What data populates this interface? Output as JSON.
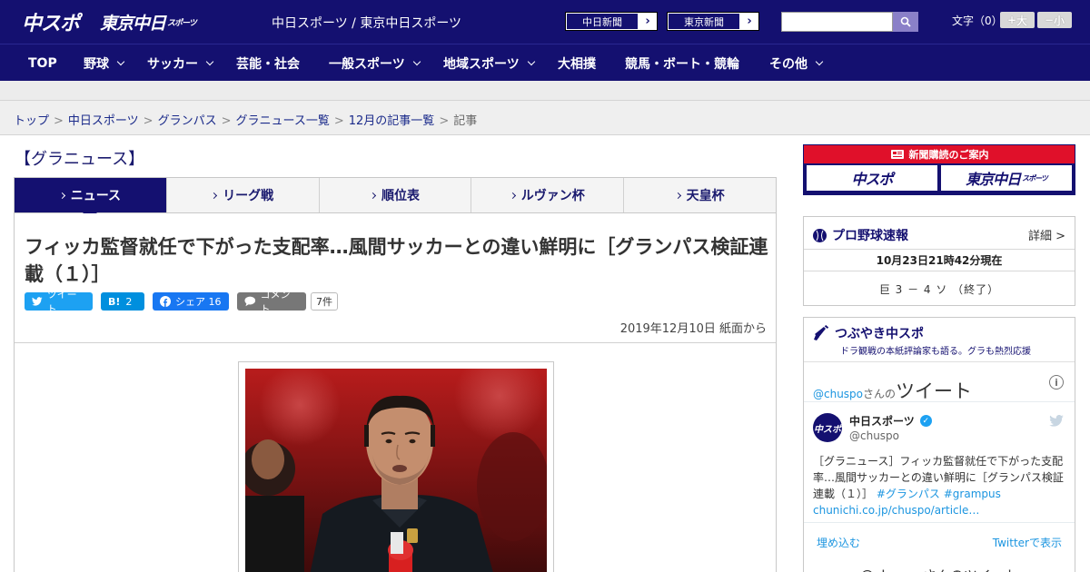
{
  "header": {
    "logo_chuspo": "中スポ",
    "logo_tokyo": "東京中日",
    "logo_tokyo_small": "スポーツ",
    "site_name": "中日スポーツ / 東京中日スポーツ",
    "links": [
      {
        "label": "中日新聞"
      },
      {
        "label": "東京新聞"
      }
    ],
    "search": {
      "value": "",
      "placeholder": ""
    },
    "font_size_label": "文字（0）",
    "font_bigger": "大",
    "font_smaller": "小"
  },
  "nav": {
    "items": [
      {
        "label": "TOP",
        "dropdown": false
      },
      {
        "label": "野球",
        "dropdown": true
      },
      {
        "label": "サッカー",
        "dropdown": true
      },
      {
        "label": "芸能・社会",
        "dropdown": false
      },
      {
        "label": "一般スポーツ",
        "dropdown": true
      },
      {
        "label": "地域スポーツ",
        "dropdown": true
      },
      {
        "label": "大相撲",
        "dropdown": false
      },
      {
        "label": "競馬・ボート・競輪",
        "dropdown": false
      },
      {
        "label": "その他",
        "dropdown": true
      }
    ]
  },
  "breadcrumb": {
    "items": [
      "トップ",
      "中日スポーツ",
      "グランパス",
      "グラニュース一覧",
      "12月の記事一覧"
    ],
    "current": "記事"
  },
  "category_title": "【グラニュース】",
  "tabs": [
    {
      "label": "ニュース",
      "active": true
    },
    {
      "label": "リーグ戦",
      "active": false
    },
    {
      "label": "順位表",
      "active": false
    },
    {
      "label": "ルヴァン杯",
      "active": false
    },
    {
      "label": "天皇杯",
      "active": false
    }
  ],
  "article": {
    "headline": "フィッカ監督就任で下がった支配率…風間サッカーとの違い鮮明に［グランパス検証連載（１）］",
    "share": {
      "tweet_label": "ツイート",
      "hatena_icon": "B!",
      "hatena_count": "2",
      "facebook_label": "シェア",
      "facebook_count": "16",
      "comment_label": "コメント",
      "comment_count": "7件"
    },
    "date": "2019年12月10日 紙面から"
  },
  "sidebar": {
    "ad": {
      "title": "新聞購読のご案内",
      "logo_left": "中スポ",
      "logo_right": "東京中日",
      "logo_right_small": "スポーツ"
    },
    "baseball": {
      "title": "プロ野球速報",
      "detail": "詳細 >",
      "time": "10月23日21時42分現在",
      "score": "巨 3 － 4 ソ （終了）"
    },
    "tweets": {
      "title": "つぶやき中スポ",
      "subtitle": "ドラ観戦の本紙評論家も語る。グラも熱烈応援",
      "handle": "@chuspo",
      "handle_suffix": "さんの",
      "handle_big": "ツイート",
      "tweet": {
        "avatar_text": "中スポ",
        "user": "中日スポーツ",
        "at": "@chuspo",
        "text": "［グラニュース］フィッカ監督就任で下がった支配率…風間サッカーとの違い鮮明に［グランパス検証連載（１）］",
        "tag1": "#グランパス",
        "tag2": "#grampus",
        "url": "chunichi.co.jp/chuspo/article…"
      },
      "embed": "埋め込む",
      "view_on_twitter": "Twitterで表示",
      "more": "@chuspoさんのツイート"
    }
  },
  "colors": {
    "navy": "#141070",
    "ad_red": "#e0102a",
    "twitter_blue": "#1da1f2"
  }
}
